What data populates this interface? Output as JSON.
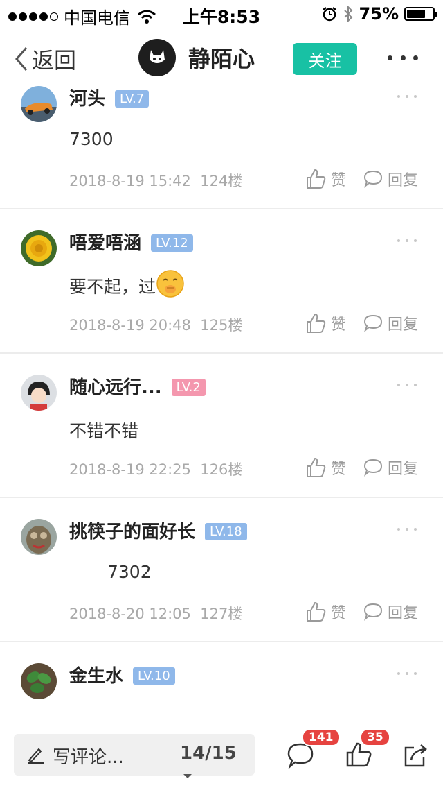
{
  "status_bar": {
    "carrier": "中国电信",
    "time": "上午8:53",
    "battery_percent": "75%",
    "battery_level": 0.75,
    "icons": [
      "signal-dots-icon",
      "wifi-icon",
      "alarm-icon",
      "bluetooth-icon",
      "battery-icon"
    ]
  },
  "nav": {
    "back_label": "返回",
    "title": "静陌心",
    "follow_label": "关注",
    "more_icon": "more-icon"
  },
  "comments": [
    {
      "name": "河头",
      "level": "LV.7",
      "level_color": "#8fb8ea",
      "text": "7300",
      "date": "2018-8-19 15:42",
      "floor": "124楼",
      "like_label": "赞",
      "reply_label": "回复"
    },
    {
      "name": "唔爱唔涵",
      "level": "LV.12",
      "level_color": "#8fb8ea",
      "text": "要不起，过",
      "emoji": "shush-face-emoji",
      "date": "2018-8-19 20:48",
      "floor": "125楼",
      "like_label": "赞",
      "reply_label": "回复"
    },
    {
      "name": "随心远行...",
      "level": "LV.2",
      "level_color": "#f497ae",
      "text": "不错不错",
      "date": "2018-8-19 22:25",
      "floor": "126楼",
      "like_label": "赞",
      "reply_label": "回复"
    },
    {
      "name": "挑筷子的面好长",
      "level": "LV.18",
      "level_color": "#8fb8ea",
      "text": "7302",
      "date": "2018-8-20 12:05",
      "floor": "127楼",
      "like_label": "赞",
      "reply_label": "回复"
    },
    {
      "name": "金生水",
      "level": "LV.10",
      "level_color": "#8fb8ea"
    }
  ],
  "bottom_bar": {
    "write_label": "写评论...",
    "page_indicator": "14/15",
    "comment_count": "141",
    "like_count": "35",
    "accent": "#18c1a4",
    "badge_color": "#e64340"
  }
}
